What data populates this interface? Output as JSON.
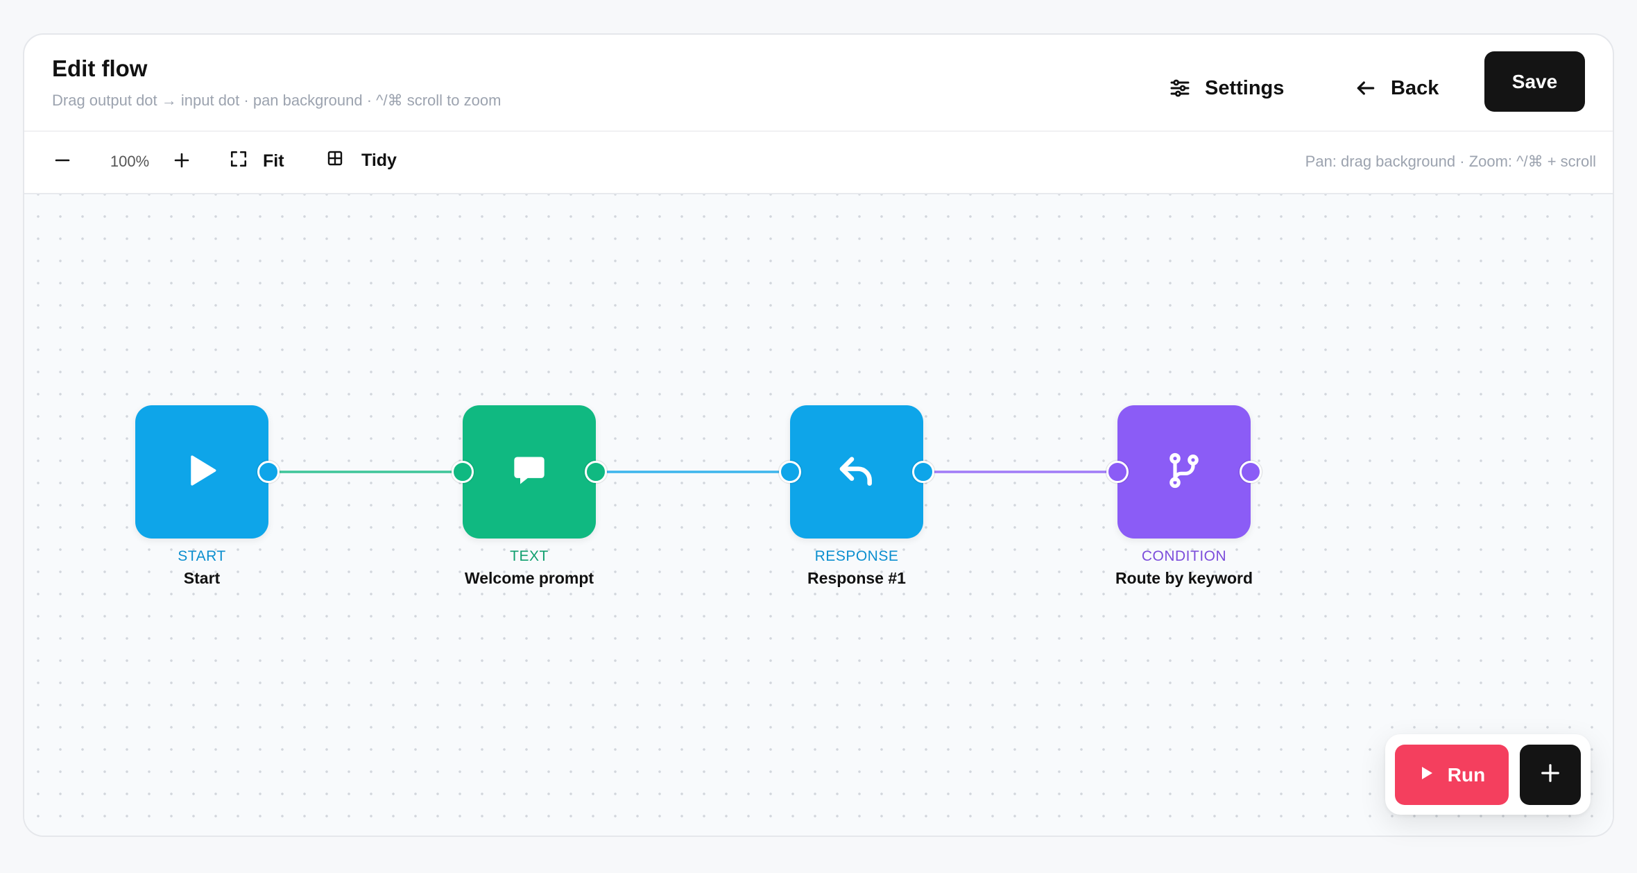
{
  "header": {
    "title": "Edit flow",
    "subtitle": "Drag output dot → input dot · pan background · ^/⌘ scroll to zoom",
    "settings_label": "Settings",
    "settings_icon": "sliders-icon",
    "back_label": "Back",
    "back_icon": "arrow-left-icon",
    "save_label": "Save"
  },
  "toolbar": {
    "zoom_out_icon": "minus-icon",
    "zoom_level": "100%",
    "zoom_in_icon": "plus-icon",
    "fit_label": "Fit",
    "fit_icon": "expand-icon",
    "tidy_label": "Tidy",
    "tidy_icon": "grid-icon",
    "hint": "Pan: drag background · Zoom: ^/⌘ + scroll"
  },
  "nodes": [
    {
      "type": "START",
      "name": "Start",
      "color": "#0ea5e9",
      "icon": "play-icon"
    },
    {
      "type": "TEXT",
      "name": "Welcome prompt",
      "color": "#10b981",
      "icon": "chat-bubble-icon"
    },
    {
      "type": "RESPONSE",
      "name": "Response #1",
      "color": "#0ea5e9",
      "icon": "reply-icon"
    },
    {
      "type": "CONDITION",
      "name": "Route by keyword",
      "color": "#8b5cf6",
      "icon": "branch-icon"
    }
  ],
  "edges": [
    {
      "from": "Start",
      "to": "Welcome prompt",
      "color": "#10b981"
    },
    {
      "from": "Welcome prompt",
      "to": "Response #1",
      "color": "#0ea5e9"
    },
    {
      "from": "Response #1",
      "to": "Route by keyword",
      "color": "#8b5cf6"
    }
  ],
  "fab": {
    "run_label": "Run",
    "run_icon": "play-icon",
    "add_icon": "plus-icon"
  },
  "colors": {
    "save_bg": "#141414",
    "run_bg": "#f43f5e"
  }
}
